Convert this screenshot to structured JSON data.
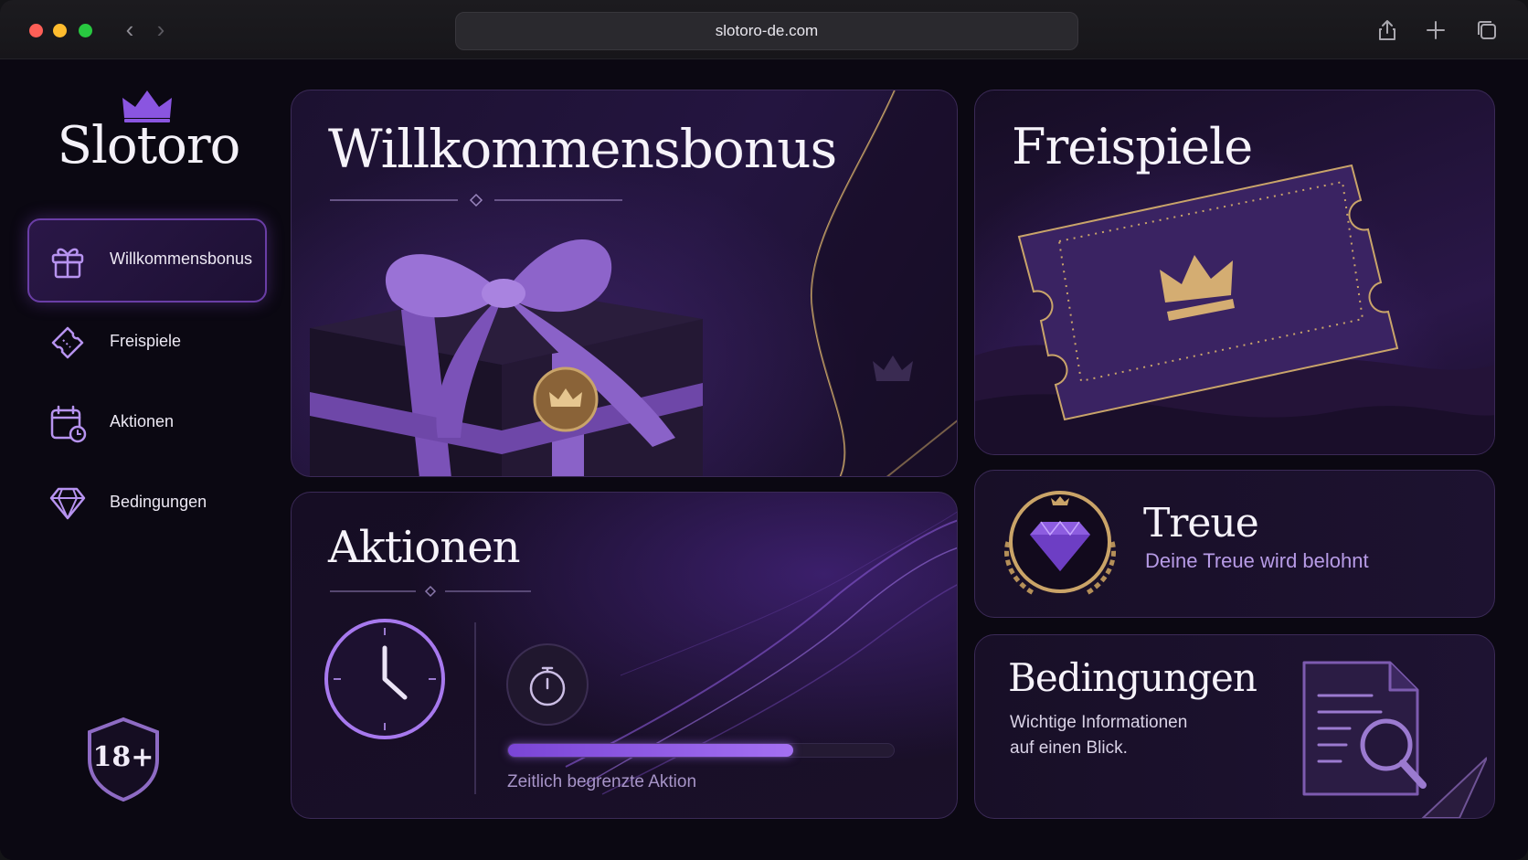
{
  "browser": {
    "url": "slotoro-de.com"
  },
  "brand": {
    "name": "Slotoro"
  },
  "sidebar": {
    "items": [
      {
        "label": "Willkommensbonus",
        "icon": "gift-icon",
        "active": true
      },
      {
        "label": "Freispiele",
        "icon": "ticket-icon",
        "active": false
      },
      {
        "label": "Aktionen",
        "icon": "calendar-clock-icon",
        "active": false
      },
      {
        "label": "Bedingungen",
        "icon": "diamond-icon",
        "active": false
      }
    ],
    "age_badge": "18+"
  },
  "cards": {
    "welcome": {
      "title": "Willkommensbonus"
    },
    "free_spins": {
      "title": "Freispiele"
    },
    "actions": {
      "title": "Aktionen",
      "progress": 0.74,
      "progress_label": "Zeitlich begrenzte Aktion"
    },
    "loyalty": {
      "title": "Treue",
      "subtitle": "Deine Treue wird belohnt"
    },
    "terms": {
      "title": "Bedingungen",
      "line1": "Wichtige Informationen",
      "line2": "auf einen Blick."
    }
  },
  "colors": {
    "accent": "#8a55e0",
    "gold": "#d3a86a",
    "background": "#0b0812"
  }
}
